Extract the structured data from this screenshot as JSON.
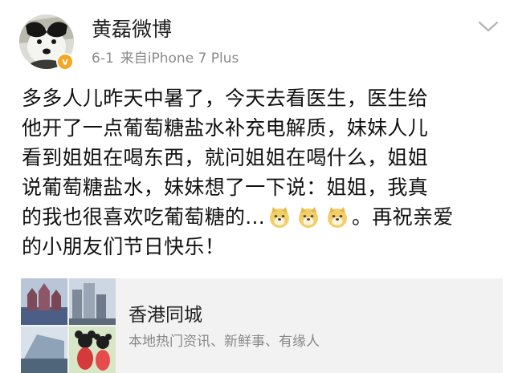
{
  "user": {
    "name": "黄磊微博",
    "verified": true,
    "verify_badge_letter": "v",
    "badge_color": "#f5a623"
  },
  "post": {
    "date": "6-1",
    "source": "来自iPhone 7 Plus",
    "lines": [
      "多多人儿昨天中暑了，今天去看医生，医生给",
      "他开了一点葡萄糖盐水补充电解质，妹妹人儿",
      "看到姐姐在喝东西，就问姐姐在喝什么，姐姐",
      "说葡萄糖盐水，妹妹想了一下说：姐姐，我真"
    ],
    "line5_text": "的我也很喜欢吃葡萄糖的...",
    "line5_after_emoji": "。再祝亲爱",
    "line6": "的小朋友们节日快乐！",
    "emoji_icon": "doge-emoji"
  },
  "card": {
    "title": "香港同城",
    "description": "本地热门资讯、新鲜事、有缘人",
    "background": "#f2f2f2"
  },
  "icons": {
    "more": "chevron-down-icon",
    "avatar": "dog-avatar"
  }
}
